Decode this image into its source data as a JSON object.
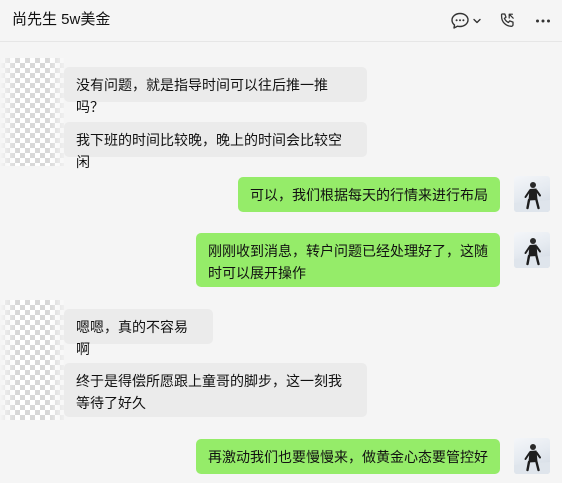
{
  "header": {
    "title": "尚先生 5w美金",
    "icons": [
      "chat-bubble-icon",
      "chevron-down-icon",
      "phone-icon",
      "more-icon"
    ]
  },
  "messages": [
    {
      "direction": "in",
      "text": "没有问题，就是指导时间可以往后推一推吗？"
    },
    {
      "direction": "in",
      "text": "我下班的时间比较晚，晚上的时间会比较空闲"
    },
    {
      "direction": "out",
      "text": "可以，我们根据每天的行情来进行布局"
    },
    {
      "direction": "out",
      "text": "刚刚收到消息，转户问题已经处理好了，这随时可以展开操作"
    },
    {
      "direction": "in",
      "text": "嗯嗯，真的不容易啊"
    },
    {
      "direction": "in",
      "text": "终于是得偿所愿跟上童哥的脚步，这一刻我等待了好久"
    },
    {
      "direction": "out",
      "text": "再激动我们也要慢慢来，做黄金心态要管控好"
    }
  ],
  "colors": {
    "background": "#f5f5f5",
    "incoming_bubble": "#ebebeb",
    "outgoing_bubble": "#95ec69"
  }
}
